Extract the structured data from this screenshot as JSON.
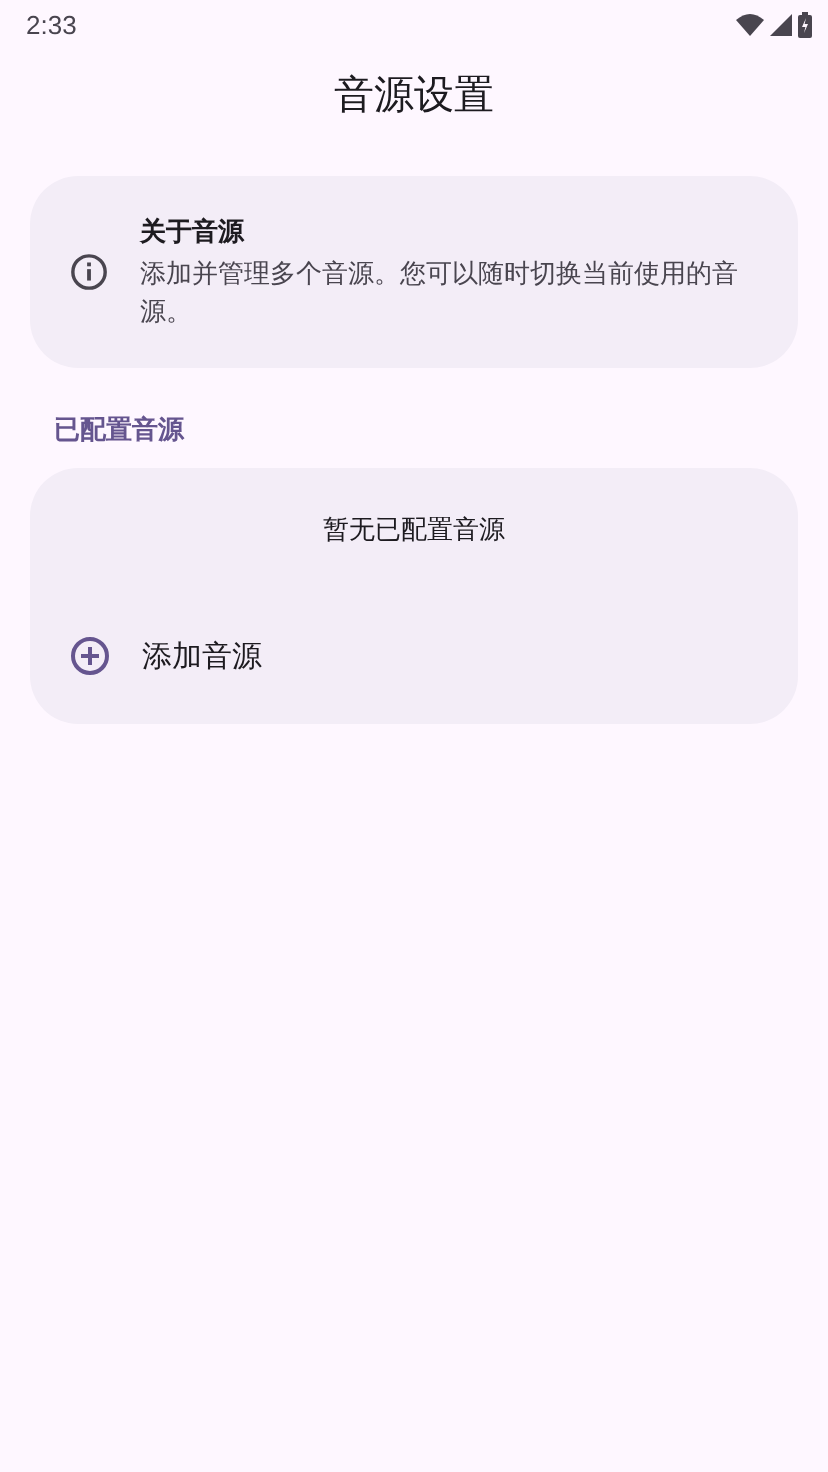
{
  "status_bar": {
    "time": "2:33"
  },
  "title": "音源设置",
  "info_card": {
    "title": "关于音源",
    "description": "添加并管理多个音源。您可以随时切换当前使用的音源。"
  },
  "section": {
    "label": "已配置音源",
    "empty_text": "暂无已配置音源",
    "add_label": "添加音源"
  }
}
